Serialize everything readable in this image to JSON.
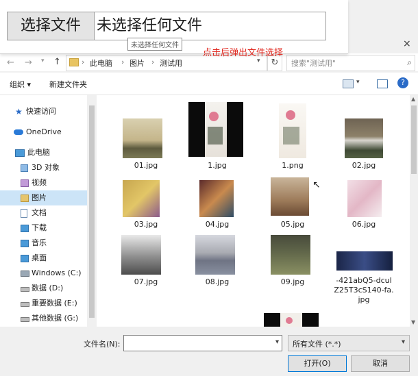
{
  "file_input": {
    "button_label": "选择文件",
    "status_text": "未选择任何文件",
    "tooltip": "未选择任何文件",
    "annotation": "点击后弹出文件选择"
  },
  "dialog": {
    "close_symbol": "×",
    "breadcrumb": [
      "此电脑",
      "图片",
      "测试用"
    ],
    "search_placeholder": "搜索\"测试用\"",
    "toolbar": {
      "organize": "组织 ▾",
      "new_folder": "新建文件夹",
      "help": "?"
    },
    "nav_items": [
      {
        "label": "快速访问",
        "icon": "star-icon"
      },
      {
        "label": "OneDrive",
        "icon": "cloud-icon"
      },
      {
        "label": "此电脑",
        "icon": "computer-icon"
      },
      {
        "label": "3D 对象",
        "icon": "cube-icon"
      },
      {
        "label": "视频",
        "icon": "video-icon"
      },
      {
        "label": "图片",
        "icon": "picture-icon",
        "selected": true
      },
      {
        "label": "文档",
        "icon": "document-icon"
      },
      {
        "label": "下载",
        "icon": "download-icon"
      },
      {
        "label": "音乐",
        "icon": "music-icon"
      },
      {
        "label": "桌面",
        "icon": "desktop-icon"
      },
      {
        "label": "Windows (C:)",
        "icon": "drive-icon"
      },
      {
        "label": "数据 (D:)",
        "icon": "drive-icon"
      },
      {
        "label": "重要数据 (E:)",
        "icon": "drive-icon"
      },
      {
        "label": "其他数据 (G:)",
        "icon": "drive-icon"
      }
    ],
    "files": [
      {
        "name": "01.jpg"
      },
      {
        "name": "1.jpg"
      },
      {
        "name": "1.png"
      },
      {
        "name": "02.jpg"
      },
      {
        "name": "03.jpg"
      },
      {
        "name": "04.jpg"
      },
      {
        "name": "05.jpg"
      },
      {
        "name": "06.jpg"
      },
      {
        "name": "07.jpg"
      },
      {
        "name": "08.jpg"
      },
      {
        "name": "09.jpg"
      },
      {
        "name": "-421abQ5-dculZ25T3cS140-fa.jpg"
      },
      {
        "name": ""
      },
      {
        "name": ""
      }
    ],
    "filename_label": "文件名(N):",
    "filename_value": "",
    "filetype_value": "所有文件 (*.*)",
    "open_label": "打开(O)",
    "cancel_label": "取消"
  }
}
